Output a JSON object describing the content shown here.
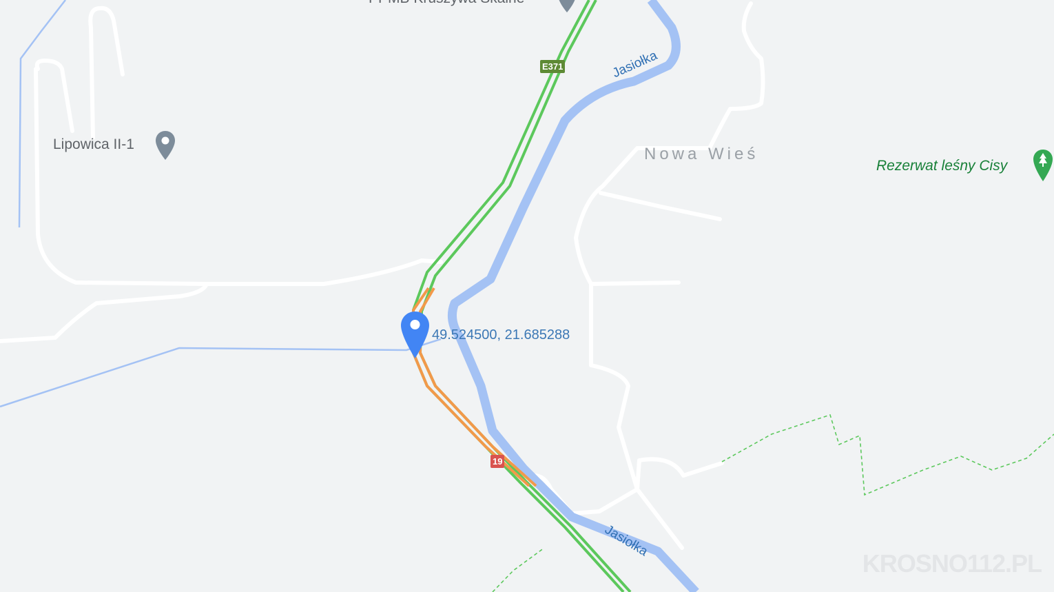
{
  "map": {
    "pois": [
      {
        "label": "Lipowica II-1",
        "icon": "place-pin-icon"
      },
      {
        "label": "PPMB Kruszywa Skalne",
        "icon": "place-pin-icon"
      }
    ],
    "village": "Nowa Wieś",
    "park": {
      "label": "Rezerwat leśny Cisy",
      "icon": "tree-pin-icon"
    },
    "river_labels": [
      "Jasiołka",
      "Jasiołka"
    ],
    "road_shields": [
      {
        "text": "E371",
        "color": "#5e8a35"
      },
      {
        "text": "19",
        "color": "#d9534f"
      }
    ],
    "dropped_pin": {
      "coordinates": "49.524500, 21.685288",
      "color": "#4285f4"
    },
    "watermark": "KROSNO112.PL",
    "colors": {
      "background": "#f1f3f4",
      "traffic_free": "#5cc85c",
      "traffic_slow": "#f2994a",
      "river": "#a4c2f4",
      "river_label": "#2f6fb3",
      "park_text": "#188038",
      "trail": "#5cc85c"
    }
  }
}
